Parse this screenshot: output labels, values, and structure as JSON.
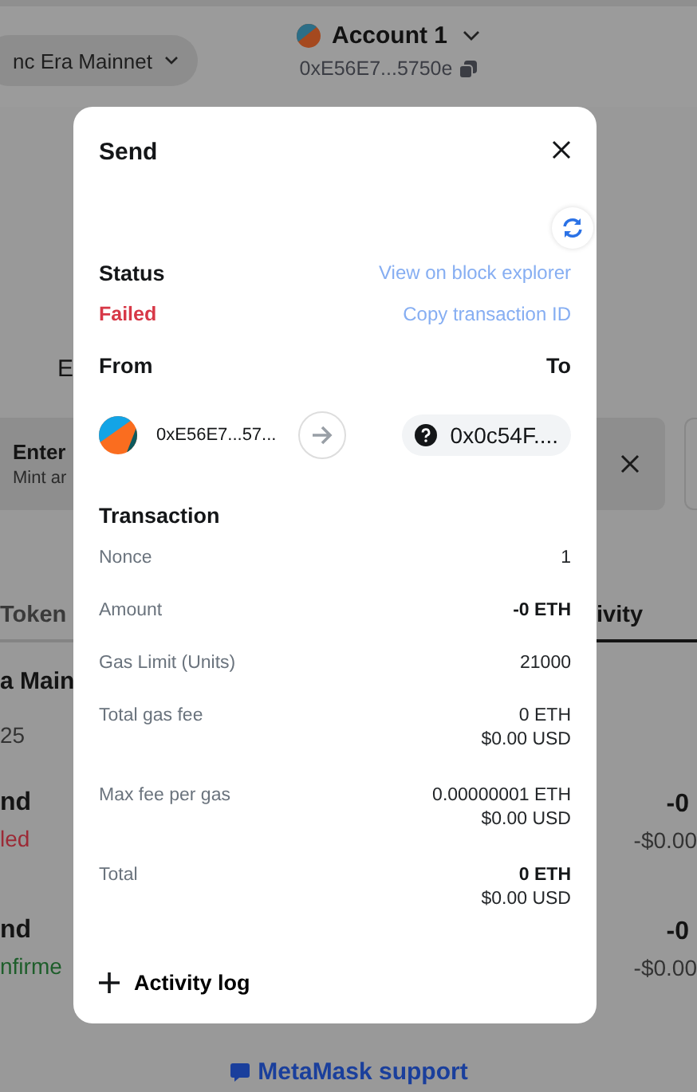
{
  "background": {
    "network_pill": "nc Era Mainnet",
    "account_name": "Account 1",
    "account_address": "0xE56E7...5750e",
    "balance_fragment": "E",
    "banner": {
      "title": "Enter",
      "body": "Mint ar"
    },
    "tabs": [
      {
        "label": "Token",
        "selected": false
      },
      {
        "label": "ivity",
        "selected": true
      }
    ],
    "network_heading": "a Main",
    "date": "25",
    "activity": [
      {
        "title": "nd",
        "status": "led",
        "kind": "failed",
        "amount": "-0",
        "fiat": "-$0.00"
      },
      {
        "title": "nd",
        "status": "nfirme",
        "kind": "confirmed",
        "amount": "-0",
        "fiat": "-$0.00"
      }
    ],
    "support_link": "MetaMask support"
  },
  "modal": {
    "title": "Send",
    "status_label": "Status",
    "status": "Failed",
    "kind": "failed",
    "links": [
      "View on block explorer",
      "Copy transaction ID"
    ],
    "from_label": "From",
    "to_label": "To",
    "from_address": "0xE56E7...57...",
    "to_address": "0x0c54F....",
    "transaction_heading": "Transaction",
    "rows": [
      {
        "label": "Nonce",
        "values": [
          "1"
        ],
        "emphasis": false
      },
      {
        "label": "Amount",
        "values": [
          "-0 ETH"
        ],
        "emphasis": true
      },
      {
        "label": "Gas Limit (Units)",
        "values": [
          "21000"
        ],
        "emphasis": false
      },
      {
        "label": "Total gas fee",
        "values": [
          "0 ETH",
          "$0.00 USD"
        ],
        "emphasis": false
      },
      {
        "label": "Max fee per gas",
        "values": [
          "0.00000001 ETH",
          "$0.00 USD"
        ],
        "emphasis": false
      },
      {
        "label": "Total",
        "values": [
          "0 ETH",
          "$0.00 USD"
        ],
        "emphasis": true
      }
    ],
    "activity_log": "Activity log"
  }
}
